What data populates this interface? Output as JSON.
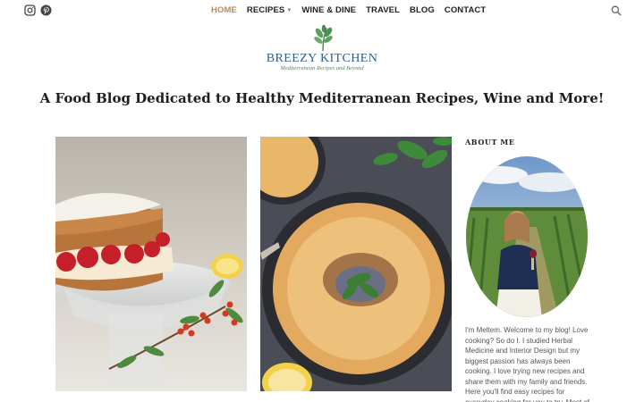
{
  "social": {
    "icons": [
      "instagram-icon",
      "pinterest-icon"
    ]
  },
  "nav": {
    "items": [
      {
        "label": "HOME",
        "active": true
      },
      {
        "label": "RECIPES",
        "dropdown": true
      },
      {
        "label": "WINE & DINE"
      },
      {
        "label": "TRAVEL"
      },
      {
        "label": "BLOG"
      },
      {
        "label": "CONTACT"
      }
    ],
    "search_icon": "search-icon"
  },
  "logo": {
    "title": "BREEZY KITCHEN",
    "tagline": "Mediterranean Recipes and Beyond"
  },
  "headline": "A Food Blog Dedicated to Healthy Mediterranean Recipes, Wine and More!",
  "featured": [
    {
      "subject": "sponge-cake-with-strawberries"
    },
    {
      "subject": "soup-bowl-with-mint"
    }
  ],
  "sidebar": {
    "about_title": "ABOUT ME",
    "about_text": "I'm Meltem. Welcome to my blog! Love cooking? So do I. I studied Herbal Medicine and Interior Design but my biggest passion has always been cooking. I love trying new recipes and share them with my family and friends. Here you'll find easy recipes for everyday cooking for you to try. Most of my recipes are from"
  },
  "colors": {
    "active_nav": "#c3884f",
    "logo_blue": "#2f5f8a",
    "logo_green": "#4f8a5b"
  }
}
